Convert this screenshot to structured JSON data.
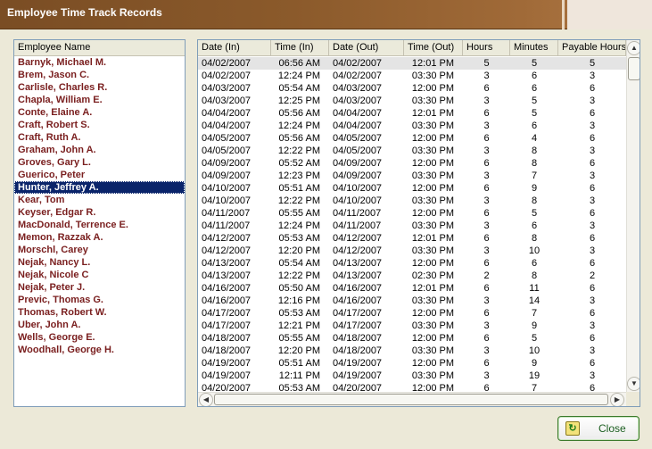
{
  "window": {
    "title": "Employee Time Track Records"
  },
  "employees": {
    "header": "Employee Name",
    "selected_index": 10,
    "items": [
      "Barnyk, Michael M.",
      "Brem, Jason C.",
      "Carlisle, Charles R.",
      "Chapla, William E.",
      "Conte, Elaine A.",
      "Craft, Robert S.",
      "Craft, Ruth A.",
      "Graham, John A.",
      "Groves, Gary L.",
      "Guerico, Peter",
      "Hunter, Jeffrey A.",
      "Kear, Tom",
      "Keyser, Edgar R.",
      "MacDonald, Terrence E.",
      "Memon, Razzak A.",
      "Morschl, Carey",
      "Nejak, Nancy L.",
      "Nejak, Nicole C",
      "Nejak, Peter J.",
      "Previc, Thomas G.",
      "Thomas, Robert W.",
      "Uber, John A.",
      "Wells, George E.",
      "Woodhall, George H."
    ]
  },
  "records": {
    "columns": [
      "Date (In)",
      "Time (In)",
      "Date (Out)",
      "Time (Out)",
      "Hours",
      "Minutes",
      "Payable Hours"
    ],
    "rows": [
      [
        "04/02/2007",
        "06:56 AM",
        "04/02/2007",
        "12:01 PM",
        "5",
        "5",
        "5"
      ],
      [
        "04/02/2007",
        "12:24 PM",
        "04/02/2007",
        "03:30 PM",
        "3",
        "6",
        "3"
      ],
      [
        "04/03/2007",
        "05:54 AM",
        "04/03/2007",
        "12:00 PM",
        "6",
        "6",
        "6"
      ],
      [
        "04/03/2007",
        "12:25 PM",
        "04/03/2007",
        "03:30 PM",
        "3",
        "5",
        "3"
      ],
      [
        "04/04/2007",
        "05:56 AM",
        "04/04/2007",
        "12:01 PM",
        "6",
        "5",
        "6"
      ],
      [
        "04/04/2007",
        "12:24 PM",
        "04/04/2007",
        "03:30 PM",
        "3",
        "6",
        "3"
      ],
      [
        "04/05/2007",
        "05:56 AM",
        "04/05/2007",
        "12:00 PM",
        "6",
        "4",
        "6"
      ],
      [
        "04/05/2007",
        "12:22 PM",
        "04/05/2007",
        "03:30 PM",
        "3",
        "8",
        "3"
      ],
      [
        "04/09/2007",
        "05:52 AM",
        "04/09/2007",
        "12:00 PM",
        "6",
        "8",
        "6"
      ],
      [
        "04/09/2007",
        "12:23 PM",
        "04/09/2007",
        "03:30 PM",
        "3",
        "7",
        "3"
      ],
      [
        "04/10/2007",
        "05:51 AM",
        "04/10/2007",
        "12:00 PM",
        "6",
        "9",
        "6"
      ],
      [
        "04/10/2007",
        "12:22 PM",
        "04/10/2007",
        "03:30 PM",
        "3",
        "8",
        "3"
      ],
      [
        "04/11/2007",
        "05:55 AM",
        "04/11/2007",
        "12:00 PM",
        "6",
        "5",
        "6"
      ],
      [
        "04/11/2007",
        "12:24 PM",
        "04/11/2007",
        "03:30 PM",
        "3",
        "6",
        "3"
      ],
      [
        "04/12/2007",
        "05:53 AM",
        "04/12/2007",
        "12:01 PM",
        "6",
        "8",
        "6"
      ],
      [
        "04/12/2007",
        "12:20 PM",
        "04/12/2007",
        "03:30 PM",
        "3",
        "10",
        "3"
      ],
      [
        "04/13/2007",
        "05:54 AM",
        "04/13/2007",
        "12:00 PM",
        "6",
        "6",
        "6"
      ],
      [
        "04/13/2007",
        "12:22 PM",
        "04/13/2007",
        "02:30 PM",
        "2",
        "8",
        "2"
      ],
      [
        "04/16/2007",
        "05:50 AM",
        "04/16/2007",
        "12:01 PM",
        "6",
        "11",
        "6"
      ],
      [
        "04/16/2007",
        "12:16 PM",
        "04/16/2007",
        "03:30 PM",
        "3",
        "14",
        "3"
      ],
      [
        "04/17/2007",
        "05:53 AM",
        "04/17/2007",
        "12:00 PM",
        "6",
        "7",
        "6"
      ],
      [
        "04/17/2007",
        "12:21 PM",
        "04/17/2007",
        "03:30 PM",
        "3",
        "9",
        "3"
      ],
      [
        "04/18/2007",
        "05:55 AM",
        "04/18/2007",
        "12:00 PM",
        "6",
        "5",
        "6"
      ],
      [
        "04/18/2007",
        "12:20 PM",
        "04/18/2007",
        "03:30 PM",
        "3",
        "10",
        "3"
      ],
      [
        "04/19/2007",
        "05:51 AM",
        "04/19/2007",
        "12:00 PM",
        "6",
        "9",
        "6"
      ],
      [
        "04/19/2007",
        "12:11 PM",
        "04/19/2007",
        "03:30 PM",
        "3",
        "19",
        "3"
      ],
      [
        "04/20/2007",
        "05:53 AM",
        "04/20/2007",
        "12:00 PM",
        "6",
        "7",
        "6"
      ]
    ]
  },
  "buttons": {
    "close_label": "Close"
  },
  "icons": {
    "scroll_up": "▲",
    "scroll_down": "▼",
    "scroll_left": "◀",
    "scroll_right": "▶",
    "close": "↻"
  }
}
